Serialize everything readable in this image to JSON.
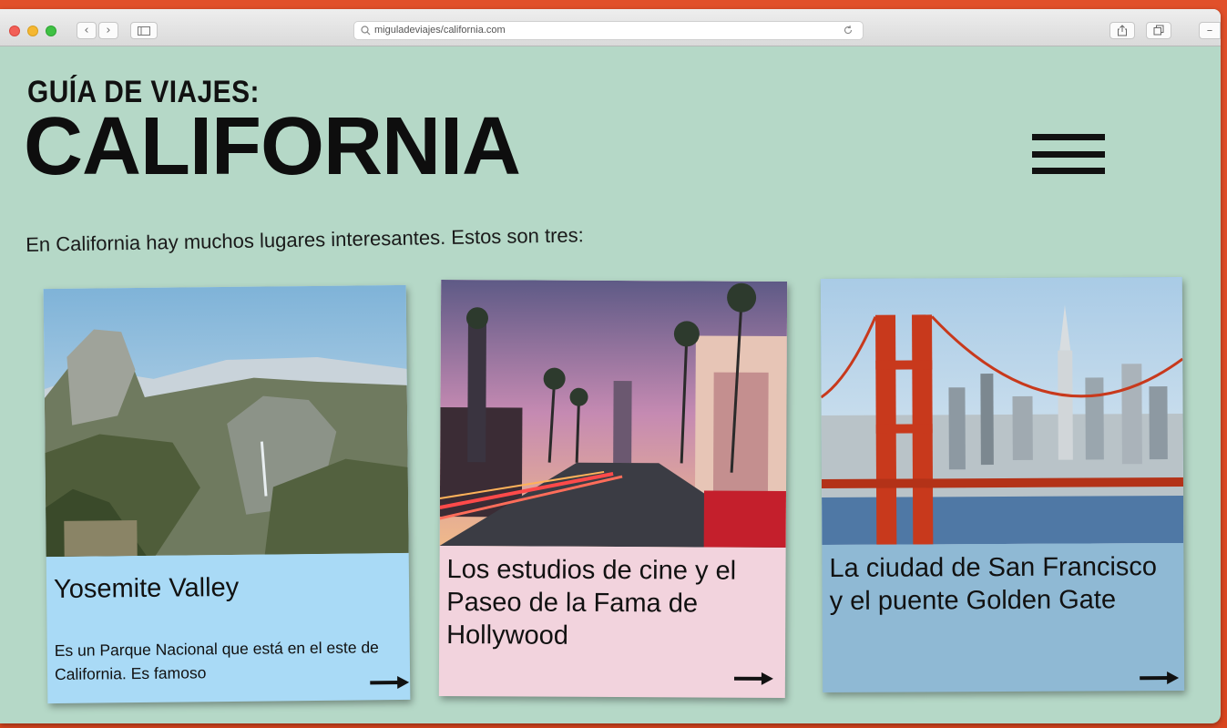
{
  "browser": {
    "url": "miguladeviajes/california.com"
  },
  "page": {
    "kicker": "GUÍA DE VIAJES:",
    "title": "CALIFORNIA",
    "intro": "En California hay muchos lugares interesantes. Estos son tres:"
  },
  "cards": [
    {
      "title": "Yosemite Valley",
      "description": "Es un Parque Nacional que está en el este de California. Es famoso",
      "color": "#a9daf6"
    },
    {
      "title": "Los estudios de cine y el Paseo de la Fama de Hollywood",
      "color": "#f2d3dd"
    },
    {
      "title": "La ciudad de San Francisco y el puente Golden Gate",
      "color": "#8fb9d4"
    }
  ],
  "colors": {
    "background": "#e1502a",
    "page": "#b5d8c7"
  },
  "icons": [
    "close-light",
    "minimize-light",
    "zoom-light",
    "back-icon",
    "forward-icon",
    "sidebar-icon",
    "search-icon",
    "reload-icon",
    "share-icon",
    "tabs-icon",
    "hamburger-menu-icon",
    "arrow-right-icon"
  ]
}
